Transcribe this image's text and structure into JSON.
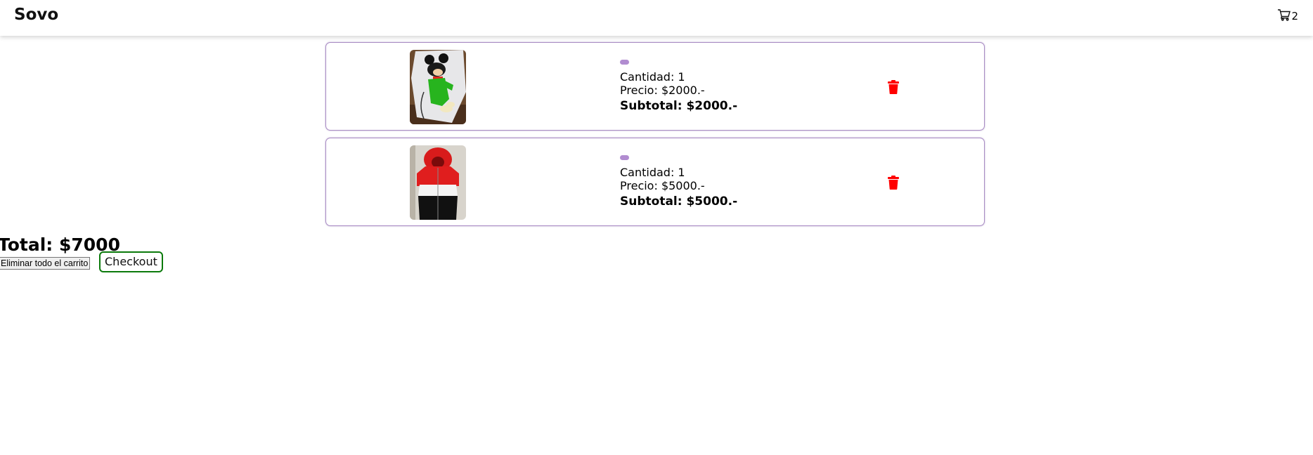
{
  "navbar": {
    "brand": "Sovo",
    "cart_count": "2"
  },
  "cart": {
    "items": [
      {
        "image": "mickey-green-tee",
        "quantity_text": "Cantidad: 1",
        "price_text": "Precio: $2000.-",
        "subtotal_text": "Subtotal: $2000.-"
      },
      {
        "image": "red-white-black-hoodie",
        "quantity_text": "Cantidad: 1",
        "price_text": "Precio: $5000.-",
        "subtotal_text": "Subtotal: $5000.-"
      }
    ],
    "total_text": "Total: $7000",
    "clear_label": "Eliminar todo el carrito",
    "checkout_label": "Checkout"
  },
  "colors": {
    "accent_border": "#a98bc4",
    "pill": "#b18cd0",
    "trash": "#ff0000",
    "checkout_border": "#0b7a0b"
  },
  "icons": {
    "cart": "cart-icon",
    "delete": "trash-icon"
  }
}
